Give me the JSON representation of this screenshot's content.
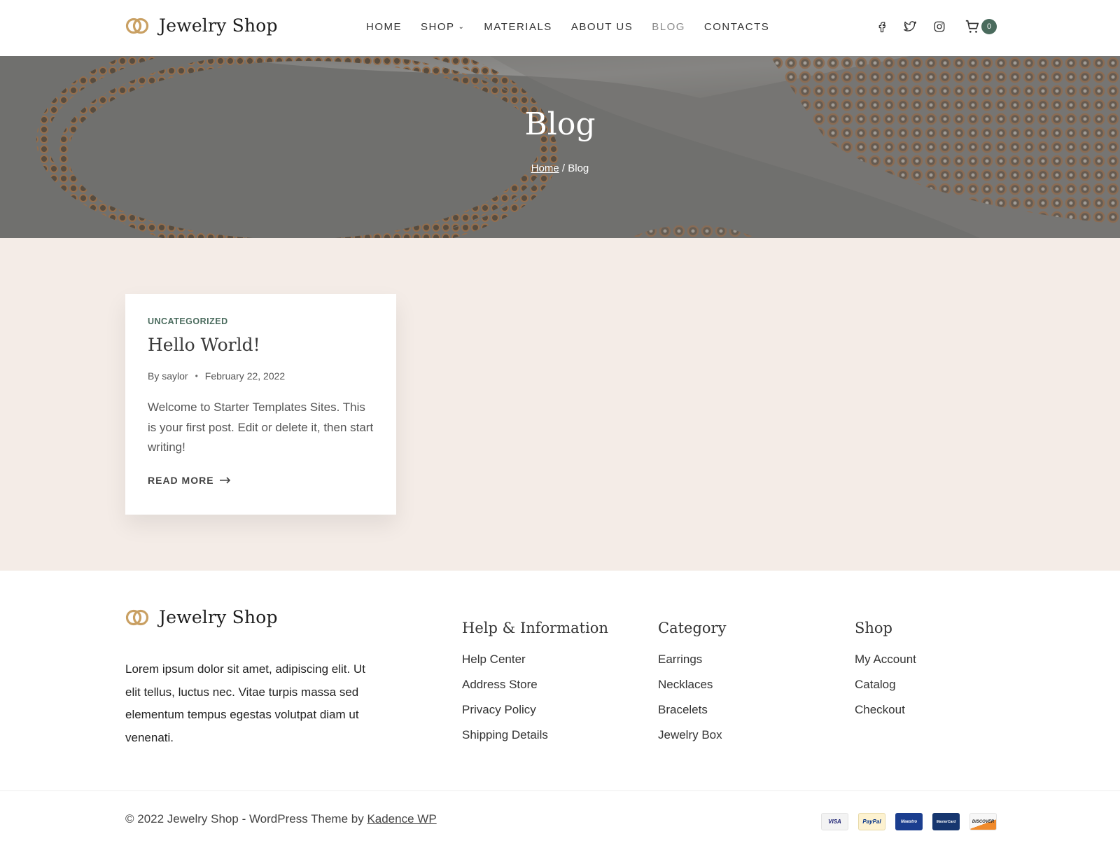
{
  "header": {
    "logo_text": "Jewelry Shop",
    "nav": [
      {
        "label": "HOME"
      },
      {
        "label": "SHOP"
      },
      {
        "label": "MATERIALS"
      },
      {
        "label": "ABOUT US"
      },
      {
        "label": "BLOG"
      },
      {
        "label": "CONTACTS"
      }
    ],
    "social_icons": [
      "facebook-icon",
      "twitter-icon",
      "instagram-icon"
    ],
    "cart_count": "0"
  },
  "hero": {
    "title": "Blog",
    "breadcrumb_home": "Home",
    "breadcrumb_sep": " / ",
    "breadcrumb_current": "Blog"
  },
  "post": {
    "category": "UNCATEGORIZED",
    "title": "Hello World!",
    "author": "By saylor",
    "date": "February 22, 2022",
    "excerpt": "Welcome to Starter Templates Sites. This is your first post. Edit or delete it, then start writing!",
    "read_more": "READ MORE"
  },
  "footer": {
    "logo_text": "Jewelry Shop",
    "description": "Lorem ipsum dolor sit amet, adipiscing elit. Ut elit tellus, luctus nec. Vitae turpis massa sed elementum tempus egestas volutpat diam ut venenati.",
    "columns": [
      {
        "title": "Help & Information",
        "links": [
          "Help Center",
          "Address Store",
          "Privacy Policy",
          "Shipping Details"
        ]
      },
      {
        "title": "Category",
        "links": [
          "Earrings",
          "Necklaces",
          "Bracelets",
          "Jewelry Box"
        ]
      },
      {
        "title": "Shop",
        "links": [
          "My Account",
          "Catalog",
          "Checkout"
        ]
      }
    ],
    "copyright_prefix": "© 2022 Jewelry Shop - WordPress Theme by ",
    "copyright_link": "Kadence WP",
    "payments": [
      "VISA",
      "PayPal",
      "Maestro",
      "MasterCard",
      "DISCOVER"
    ]
  },
  "colors": {
    "accent_green": "#4a6b5d",
    "logo_gold": "#c9a063",
    "content_bg": "#f4ece7"
  }
}
